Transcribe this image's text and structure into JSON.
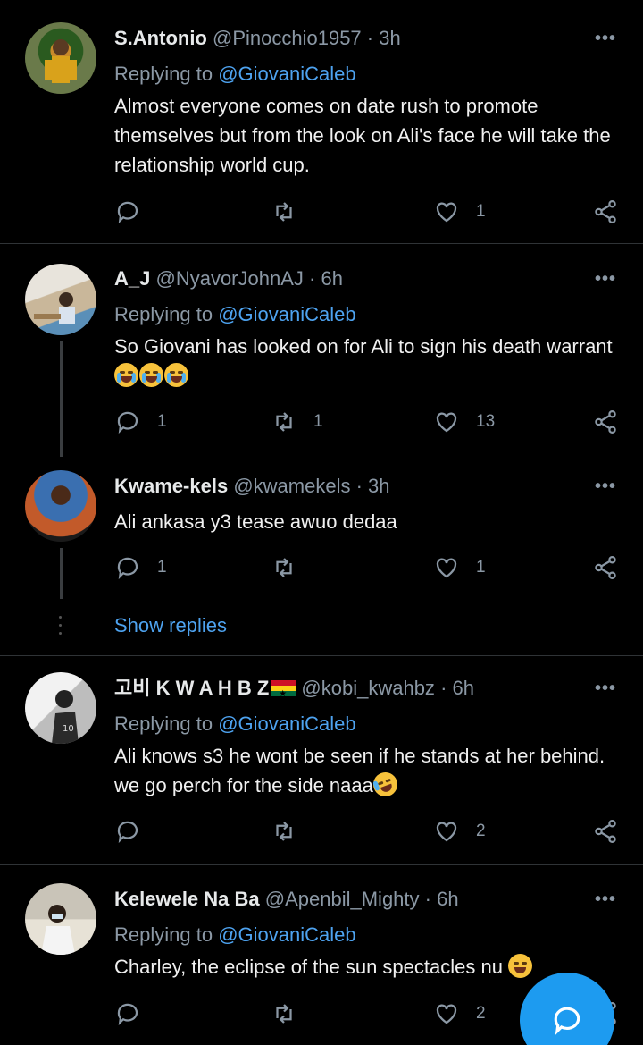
{
  "colors": {
    "background": "#000000",
    "accent": "#1d9bf0",
    "mention": "#4ea3f0",
    "muted": "#8b98a5"
  },
  "tweets": [
    {
      "name": "S.Antonio",
      "handle": "@Pinocchio1957",
      "dot": "·",
      "time": "3h",
      "reply_label": "Replying to",
      "reply_mention": "@GiovaniCaleb",
      "text": "Almost everyone comes on date rush to promote themselves but from the look on Ali's face he will take the relationship world cup.",
      "replies": "",
      "retweets": "",
      "likes": "1"
    },
    {
      "name": "A_J",
      "handle": "@NyavorJohnAJ",
      "dot": "·",
      "time": "6h",
      "reply_label": "Replying to",
      "reply_mention": "@GiovaniCaleb",
      "text": "So Giovani has looked on for Ali to sign his death warrant",
      "emoji": [
        "loudly-crying-face",
        "loudly-crying-face",
        "loudly-crying-face"
      ],
      "replies": "1",
      "retweets": "1",
      "likes": "13"
    },
    {
      "name": "Kwame-kels",
      "handle": "@kwamekels",
      "dot": "·",
      "time": "3h",
      "text": "Ali ankasa y3 tease awuo dedaa",
      "replies": "1",
      "retweets": "",
      "likes": "1"
    },
    {
      "name": "고비 K W A H B Z",
      "flag": "ghana-flag",
      "handle": "@kobi_kwahbz",
      "dot": "·",
      "time": "6h",
      "reply_label": "Replying to",
      "reply_mention": "@GiovaniCaleb",
      "text": "Ali knows s3 he wont be seen if he stands at her behind. we go perch for the side naaa",
      "emoji": [
        "rolling-laughing-face"
      ],
      "replies": "",
      "retweets": "",
      "likes": "2"
    },
    {
      "name": "Kelewele Na Ba",
      "handle": "@Apenbil_Mighty",
      "dot": "·",
      "time": "6h",
      "reply_label": "Replying to",
      "reply_mention": "@GiovaniCaleb",
      "text": "Charley,  the eclipse of the sun spectacles nu",
      "emoji": [
        "grinning-squinting-face"
      ],
      "replies": "",
      "retweets": "",
      "likes": "2"
    }
  ],
  "show_replies_label": "Show replies",
  "more_label": "•••",
  "icons": {
    "reply": "reply-icon",
    "retweet": "retweet-icon",
    "like": "heart-icon",
    "share": "share-icon",
    "compose": "compose-reply-icon"
  }
}
